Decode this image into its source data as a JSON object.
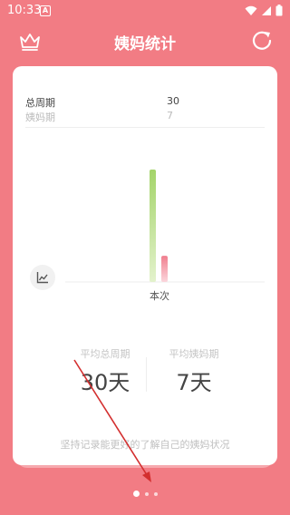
{
  "status_bar": {
    "time": "10:33",
    "notification_letter": "A"
  },
  "header": {
    "title": "姨妈统计"
  },
  "legend": [
    {
      "label": "总周期",
      "value": "30"
    },
    {
      "label": "姨妈期",
      "value": "7"
    }
  ],
  "chart_data": {
    "type": "bar",
    "categories": [
      "本次"
    ],
    "series": [
      {
        "values": [
          30
        ],
        "color": "#A9D56A"
      },
      {
        "values": [
          7
        ],
        "color": "#F28B98"
      }
    ],
    "xlabel": "",
    "ylabel": "",
    "grid": false
  },
  "stats": [
    {
      "label": "平均总周期",
      "value": "30天"
    },
    {
      "label": "平均姨妈期",
      "value": "7天"
    }
  ],
  "footer_text": "坚持记录能更好的了解自己的姨妈状况",
  "pagination": {
    "pages": 3,
    "current": 1
  },
  "colors": {
    "background": "#F27C84",
    "card": "#FFFFFF",
    "annotation": "#D32F2F"
  }
}
